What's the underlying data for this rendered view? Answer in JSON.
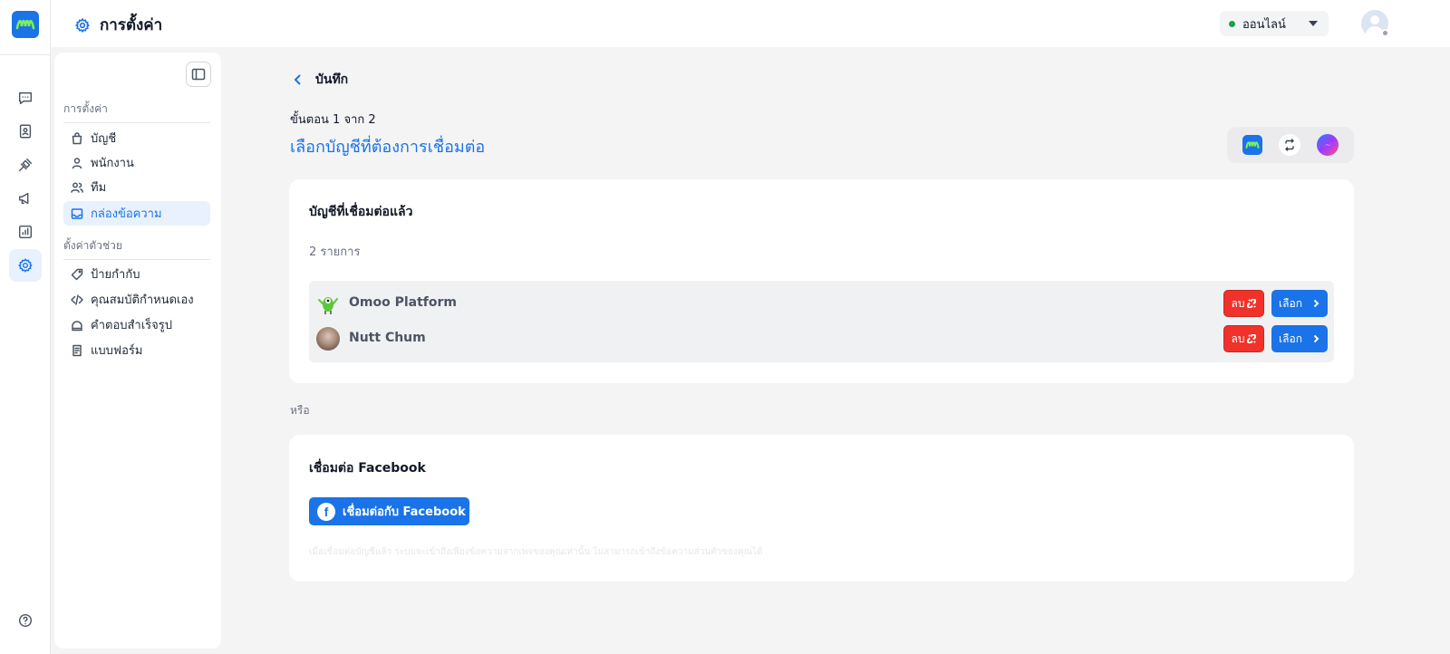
{
  "header": {
    "title": "การตั้งค่า",
    "status": "ออนไลน์"
  },
  "rail": {
    "items": [
      "chat-icon",
      "contacts-icon",
      "integration-icon",
      "broadcast-icon",
      "report-icon",
      "settings-icon"
    ],
    "active": "settings-icon",
    "help": "help-icon"
  },
  "sidebar": {
    "group1": "การตั้งค่า",
    "items1": [
      {
        "label": "บัญชี",
        "icon": "bag-icon"
      },
      {
        "label": "พนักงาน",
        "icon": "user-icon"
      },
      {
        "label": "ทีม",
        "icon": "team-icon"
      },
      {
        "label": "กล่องข้อความ",
        "icon": "inbox-icon"
      }
    ],
    "group2": "ตั้งค่าตัวช่วย",
    "items2": [
      {
        "label": "ป้ายกำกับ",
        "icon": "tag-icon"
      },
      {
        "label": "คุณสมบัติกำหนดเอง",
        "icon": "code-icon"
      },
      {
        "label": "คำตอบสำเร็จรูป",
        "icon": "quick-reply-icon"
      },
      {
        "label": "แบบฟอร์ม",
        "icon": "form-icon"
      }
    ],
    "active": "กล่องข้อความ"
  },
  "main": {
    "back_label": "บันทึก",
    "step": "ขั้นตอน 1 จาก 2",
    "title": "เลือกบัญชีที่ต้องการเชื่อมต่อ",
    "channels": [
      "omoo-logo-icon",
      "sync-icon",
      "messenger-icon"
    ]
  },
  "connected": {
    "title": "บัญชีที่เชื่อมต่อแล้ว",
    "count": "2 รายการ",
    "accounts": [
      {
        "name": "Omoo Platform",
        "delete_label": "ลบ",
        "select_label": "เลือก"
      },
      {
        "name": "Nutt Chum",
        "delete_label": "ลบ",
        "select_label": "เลือก"
      }
    ]
  },
  "or_label": "หรือ",
  "facebook": {
    "title": "เชื่อมต่อ Facebook",
    "button_label": "เชื่อมต่อกับ Facebook",
    "note": "เมื่อเชื่อมต่อบัญชีแล้ว ระบบจะเข้าถึงเพียงข้อความจากเพจของคุณเท่านั้น ไม่สามารถเข้าถึงข้อความส่วนตัวของคุณได้"
  },
  "colors": {
    "accent": "#1a73e8",
    "danger": "#f0322a",
    "online": "#16a34a"
  }
}
